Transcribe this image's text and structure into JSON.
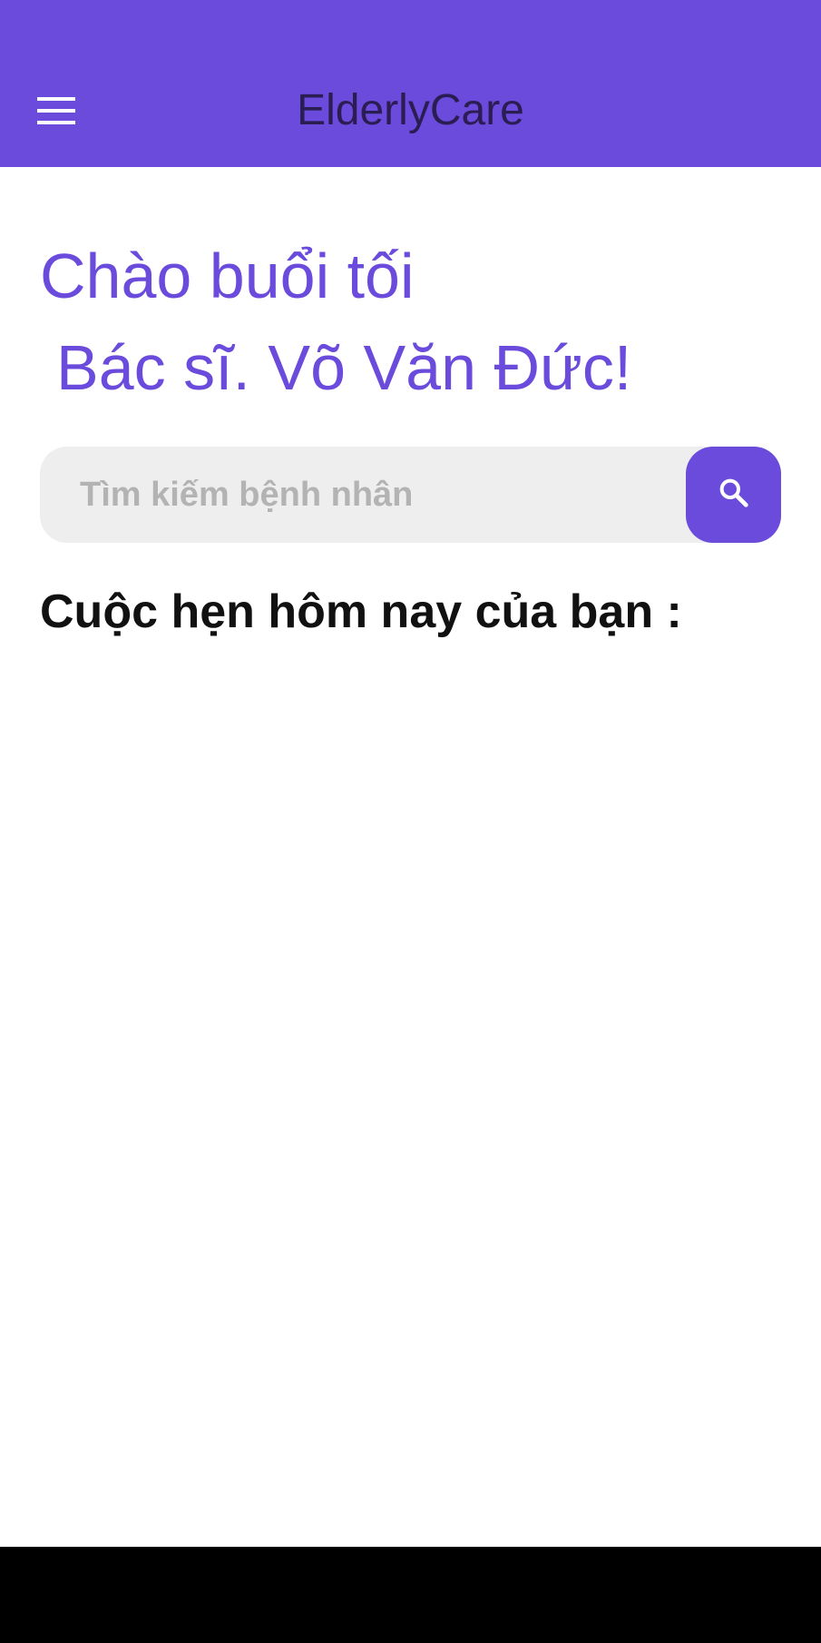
{
  "app_bar": {
    "title": "ElderlyCare",
    "menu_icon": "hamburger-menu-icon",
    "background_color": "#6a4bdc"
  },
  "greeting": {
    "line1": "Chào buổi tối",
    "line2": "Bác sĩ. Võ Văn Đức!",
    "color": "#6a4bdc"
  },
  "search": {
    "placeholder": "Tìm kiếm bệnh nhân",
    "value": "",
    "button_icon": "search-icon"
  },
  "appointments": {
    "heading": "Cuộc hẹn hôm nay của bạn :",
    "items": []
  }
}
